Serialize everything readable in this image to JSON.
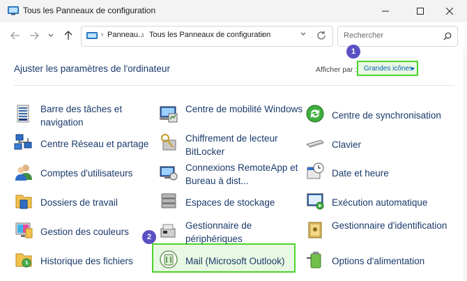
{
  "window": {
    "title": "Tous les Panneaux de configuration"
  },
  "nav": {
    "breadcrumb": [
      "Panneau...",
      "Tous les Panneaux de configuration"
    ],
    "search_placeholder": "Rechercher"
  },
  "header": {
    "heading": "Ajuster les paramètres de l'ordinateur",
    "view_by_label": "Afficher par :",
    "view_by_value": "Grandes icônes"
  },
  "badges": [
    "1",
    "2"
  ],
  "items": [
    {
      "label": "Barre des tâches et navigation",
      "icon": "taskbar-icon"
    },
    {
      "label": "Centre de mobilité Windows",
      "icon": "mobility-center-icon"
    },
    {
      "label": "Centre de synchronisation",
      "icon": "sync-center-icon"
    },
    {
      "label": "Centre Réseau et partage",
      "icon": "network-icon"
    },
    {
      "label": "Chiffrement de lecteur BitLocker",
      "icon": "bitlocker-icon"
    },
    {
      "label": "Clavier",
      "icon": "keyboard-icon"
    },
    {
      "label": "Comptes d'utilisateurs",
      "icon": "users-icon"
    },
    {
      "label": "Connexions RemoteApp et Bureau à dist...",
      "icon": "remoteapp-icon"
    },
    {
      "label": "Date et heure",
      "icon": "clock-icon"
    },
    {
      "label": "Dossiers de travail",
      "icon": "work-folders-icon"
    },
    {
      "label": "Espaces de stockage",
      "icon": "storage-spaces-icon"
    },
    {
      "label": "Exécution automatique",
      "icon": "autoplay-icon"
    },
    {
      "label": "Gestion des couleurs",
      "icon": "color-management-icon"
    },
    {
      "label": "Gestionnaire de périphériques",
      "icon": "device-manager-icon"
    },
    {
      "label": "Gestionnaire d'identification",
      "icon": "credential-manager-icon"
    },
    {
      "label": "Historique des fichiers",
      "icon": "file-history-icon"
    },
    {
      "label": "Mail (Microsoft Outlook)",
      "icon": "mail-outlook-icon"
    },
    {
      "label": "Options d'alimentation",
      "icon": "power-options-icon"
    }
  ],
  "colors": {
    "link": "#1a3a6a",
    "highlight_border": "#4cd42a",
    "badge": "#5b4fc4"
  }
}
